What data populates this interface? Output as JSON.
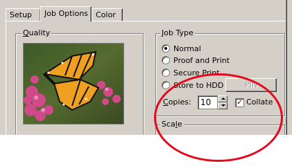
{
  "tabs": [
    {
      "label": "Setup"
    },
    {
      "label": "Job Options"
    },
    {
      "label": "Color"
    }
  ],
  "quality": {
    "legend_u": "Q",
    "legend_rest": "uality"
  },
  "job_type": {
    "legend_u": "J",
    "legend_rest": "ob Type",
    "options": [
      {
        "label": "Normal",
        "checked": true
      },
      {
        "label": "Proof and Print",
        "checked": false
      },
      {
        "label": "Secure Print",
        "checked": false
      },
      {
        "label": "Store to HDD",
        "checked": false
      }
    ],
    "pin_button": "PIN"
  },
  "copies": {
    "label_u": "C",
    "label_rest": "opies:",
    "value": "10"
  },
  "collate": {
    "label": "Collate",
    "checked": true
  },
  "scale": {
    "legend_main": "Sca",
    "legend_u": "l",
    "legend_rest": "e"
  },
  "colors": {
    "dialog": "#d4d0c8",
    "annotation": "#e5091f"
  }
}
